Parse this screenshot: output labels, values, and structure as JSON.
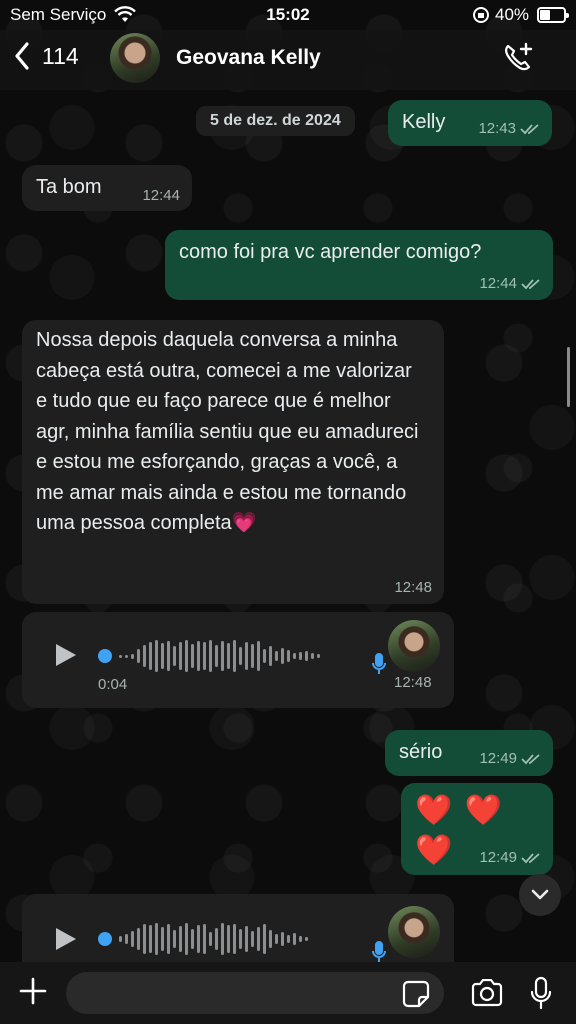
{
  "status_bar": {
    "carrier": "Sem Serviço",
    "time": "15:02",
    "battery": "40%"
  },
  "header": {
    "back_count": "114",
    "contact_name": "Geovana Kelly"
  },
  "date_separator": "5 de dez. de 2024",
  "messages": [
    {
      "dir": "out",
      "text": "Kelly",
      "time": "12:43"
    },
    {
      "dir": "in",
      "text": "Ta bom",
      "time": "12:44"
    },
    {
      "dir": "out",
      "text": "como foi pra vc aprender comigo?",
      "time": "12:44"
    },
    {
      "dir": "in",
      "text": "Nossa depois daquela conversa a minha cabeça está outra, comecei a me valorizar e tudo que eu faço parece que é melhor agr, minha família sentiu que eu amadureci e estou me esforçando, graças a você, a me amar mais ainda e estou me tornando uma pessoa completa💗",
      "time": "12:48"
    },
    {
      "dir": "out",
      "text": "sério",
      "time": "12:49"
    },
    {
      "dir": "out",
      "text": "❤️ ❤️ ❤️",
      "time": "12:49"
    }
  ],
  "voice_notes": [
    {
      "duration": "0:04",
      "time": "12:48"
    },
    {
      "duration": "",
      "time": ""
    }
  ],
  "composer": {
    "placeholder": ""
  },
  "colors": {
    "incoming_bubble": "#1f1f1f",
    "outgoing_bubble": "#144d37",
    "waveform_dot": "#3fa2f2"
  }
}
